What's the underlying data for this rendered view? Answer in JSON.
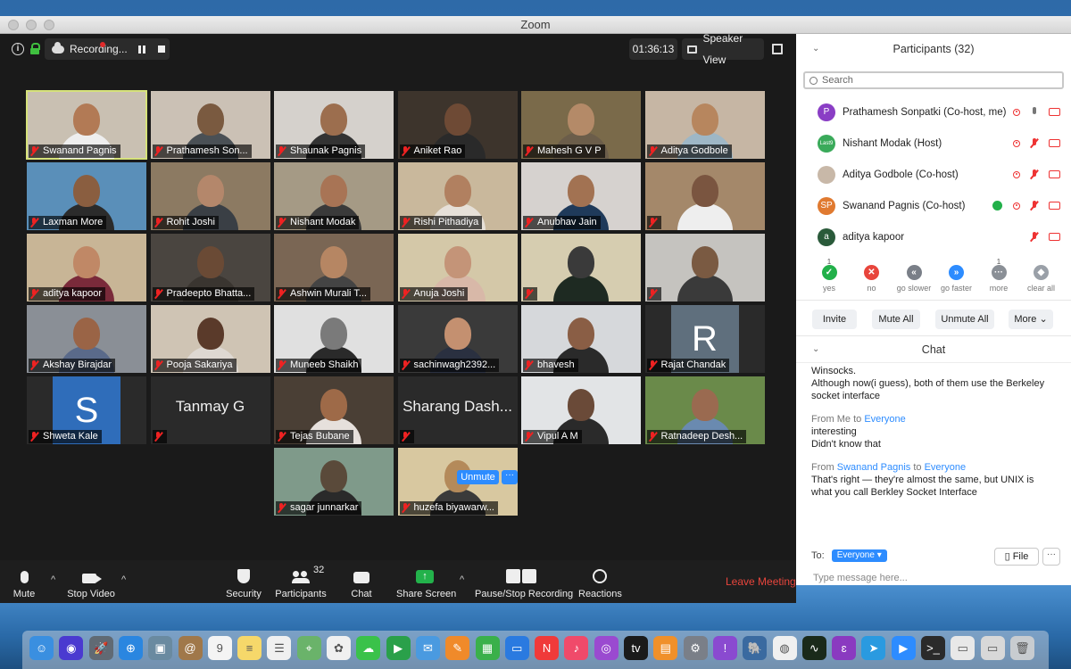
{
  "window": {
    "title": "Zoom"
  },
  "topbar": {
    "recording_label": "Recording...",
    "timer": "01:36:13",
    "view_label": "Speaker View"
  },
  "tiles": [
    {
      "name": "Swanand Pagnis",
      "type": "video",
      "skin": "#b27a55",
      "shirt": "#eee",
      "bg": "#c9c0b2",
      "active": true
    },
    {
      "name": "Prathamesh Son...",
      "type": "video",
      "skin": "#7a5a40",
      "shirt": "#4a5055",
      "bg": "#cbc1b5"
    },
    {
      "name": "Shaunak Pagnis",
      "type": "video",
      "skin": "#9c6e4e",
      "shirt": "#333",
      "bg": "#d5d1cc"
    },
    {
      "name": "Aniket Rao",
      "type": "video",
      "skin": "#6e4a35",
      "shirt": "#2a2a2a",
      "bg": "#3d342c"
    },
    {
      "name": "Mahesh G V P",
      "type": "video",
      "skin": "#b48a68",
      "shirt": "#6b5d4a",
      "bg": "#7a6a4a"
    },
    {
      "name": "Aditya Godbole",
      "type": "video",
      "skin": "#b7865e",
      "shirt": "#9eb7c6",
      "bg": "#c6b6a4"
    },
    {
      "name": "Laxman More",
      "type": "video",
      "skin": "#8a5e40",
      "shirt": "#2b2b2b",
      "bg": "#5a8fb9"
    },
    {
      "name": "Rohit Joshi",
      "type": "video",
      "skin": "#b4876b",
      "shirt": "#3a3f45",
      "bg": "#8c7a62"
    },
    {
      "name": "Nishant Modak",
      "type": "video",
      "skin": "#a87455",
      "shirt": "#3a3a3a",
      "bg": "#a59a85"
    },
    {
      "name": "Rishi Pithadiya",
      "type": "video",
      "skin": "#b18060",
      "shirt": "#e6e0d8",
      "bg": "#c9b89c"
    },
    {
      "name": "Anubhav Jain",
      "type": "video",
      "skin": "#a27252",
      "shirt": "#1f3a5a",
      "bg": "#d6d2cf"
    },
    {
      "name": "",
      "type": "video",
      "skin": "#7a5540",
      "shirt": "#eee",
      "bg": "#a4886a"
    },
    {
      "name": "aditya kapoor",
      "type": "video",
      "skin": "#c08866",
      "shirt": "#7a2a3a",
      "bg": "#c8b596"
    },
    {
      "name": "Pradeepto Bhatta...",
      "type": "video",
      "skin": "#6a4a35",
      "shirt": "#3a3530",
      "bg": "#4a4540"
    },
    {
      "name": "Ashwin Murali T...",
      "type": "video",
      "skin": "#b68663",
      "shirt": "#444",
      "bg": "#7a6654"
    },
    {
      "name": "Anuja Joshi",
      "type": "video",
      "skin": "#c49478",
      "shirt": "#d8b8a8",
      "bg": "#d4c8a8"
    },
    {
      "name": "",
      "type": "video",
      "skin": "#3a3a3a",
      "shirt": "#1e2a22",
      "bg": "#d6cdb0"
    },
    {
      "name": "",
      "type": "video",
      "skin": "#7a5a42",
      "shirt": "#3a3a3a",
      "bg": "#c5c3bf"
    },
    {
      "name": "Akshay Birajdar",
      "type": "video",
      "skin": "#9a6446",
      "shirt": "#5a6a8a",
      "bg": "#8a8f96"
    },
    {
      "name": "Pooja Sakariya",
      "type": "video",
      "skin": "#5a3a2a",
      "shirt": "#ded8d2",
      "bg": "#cfc4b4"
    },
    {
      "name": "Muneeb Shaikh",
      "type": "video",
      "skin": "#7a7a7a",
      "shirt": "#2a2a2a",
      "bg": "#e0e0e0"
    },
    {
      "name": "sachinwagh2392...",
      "type": "video",
      "skin": "#c49070",
      "shirt": "#2a3040",
      "bg": "#3a3a3a"
    },
    {
      "name": "bhavesh",
      "type": "video",
      "skin": "#8a5e45",
      "shirt": "#2a2a2a",
      "bg": "#d6d8db"
    },
    {
      "name": "Rajat Chandak",
      "type": "avatar",
      "letter": "R",
      "avatar_bg": "#5f6f7d"
    },
    {
      "name": "Shweta Kale",
      "type": "avatar",
      "letter": "S",
      "avatar_bg": "#2f6dba"
    },
    {
      "name": "",
      "type": "text",
      "label": "Tanmay G"
    },
    {
      "name": "Tejas Bubane",
      "type": "video",
      "skin": "#9e6a48",
      "shirt": "#e6e0dc",
      "bg": "#4a3f35"
    },
    {
      "name": "",
      "type": "text",
      "label": "Sharang Dash..."
    },
    {
      "name": "Vipul A M",
      "type": "video",
      "skin": "#6a4a38",
      "shirt": "#2a2a2a",
      "bg": "#e2e4e6"
    },
    {
      "name": "Ratnadeep Desh...",
      "type": "video",
      "skin": "#9a6a50",
      "shirt": "#6a8ab0",
      "bg": "#6a8a4a"
    },
    {
      "name": "sagar junnarkar",
      "type": "video",
      "skin": "#5a4a3a",
      "shirt": "#2a2a2a",
      "bg": "#7f9a8a"
    },
    {
      "name": "huzefa biyawarw...",
      "type": "video",
      "skin": "#b48a5a",
      "shirt": "#3a3a3a",
      "bg": "#d8c8a0",
      "unmute": true
    }
  ],
  "overlay": {
    "unmute_label": "Unmute",
    "more_label": "···"
  },
  "toolbar": {
    "mute": "Mute",
    "stop_video": "Stop Video",
    "security": "Security",
    "participants": "Participants",
    "participants_count": "32",
    "chat": "Chat",
    "share_screen": "Share Screen",
    "pause_stop_recording": "Pause/Stop Recording",
    "reactions": "Reactions",
    "leave": "Leave Meeting"
  },
  "participants_panel": {
    "title": "Participants (32)",
    "search_placeholder": "Search",
    "people": [
      {
        "name": "Prathamesh Sonpatki  (Co-host, me)",
        "initials": "P",
        "color": "#8a3ec5"
      },
      {
        "name": "Nishant Modak (Host)",
        "initials": "Last9",
        "color": "#3aaa5a"
      },
      {
        "name": "Aditya Godbole (Co-host)",
        "initials": "",
        "color": "#c8b8a8"
      },
      {
        "name": "Swanand Pagnis (Co-host)",
        "initials": "SP",
        "color": "#e07a30"
      },
      {
        "name": "aditya kapoor",
        "initials": "a",
        "color": "#2a5a3a"
      }
    ],
    "feedback": [
      {
        "label": "yes",
        "count": "1",
        "color": "#22b04a",
        "glyph": "✓"
      },
      {
        "label": "no",
        "count": "",
        "color": "#e8453c",
        "glyph": "✕"
      },
      {
        "label": "go slower",
        "count": "",
        "color": "#7a7f88",
        "glyph": "«"
      },
      {
        "label": "go faster",
        "count": "",
        "color": "#2d8cff",
        "glyph": "»"
      },
      {
        "label": "more",
        "count": "1",
        "color": "#8a8f96",
        "glyph": "···"
      },
      {
        "label": "clear all",
        "count": "",
        "color": "#9aa0a8",
        "glyph": "◆"
      }
    ],
    "buttons": {
      "invite": "Invite",
      "mute_all": "Mute All",
      "unmute_all": "Unmute All",
      "more": "More ⌄"
    }
  },
  "chat": {
    "title": "Chat",
    "messages": [
      {
        "from": "",
        "to": "",
        "lines": [
          "Winsocks.",
          "Although now(i guess), both of them use the Berkeley",
          "socket interface"
        ]
      },
      {
        "from": "Me",
        "to": "Everyone",
        "lines": [
          "interesting",
          "Didn't know that"
        ]
      },
      {
        "from": "Swanand Pagnis",
        "to": "Everyone",
        "lines": [
          "That's right — they're almost the same, but UNIX is",
          "what you call Berkley Socket Interface"
        ]
      }
    ],
    "from_label": "From",
    "to_label": "to",
    "to_field_label": "To:",
    "recipient": "Everyone ▾",
    "file_label": "File",
    "more_label": "···",
    "input_placeholder": "Type message here..."
  },
  "dock": {
    "apps": [
      {
        "name": "finder-icon",
        "color": "#3a8fe0",
        "glyph": "☺"
      },
      {
        "name": "siri-icon",
        "color": "#4a3ad0",
        "glyph": "◉"
      },
      {
        "name": "launchpad-icon",
        "color": "#606a74",
        "glyph": "🚀"
      },
      {
        "name": "safari-icon",
        "color": "#2a86e0",
        "glyph": "⊕"
      },
      {
        "name": "preview-icon",
        "color": "#6a8aa0",
        "glyph": "▣"
      },
      {
        "name": "contacts-icon",
        "color": "#a0784a",
        "glyph": "@"
      },
      {
        "name": "calendar-icon",
        "color": "#f4f4f4",
        "glyph": "9"
      },
      {
        "name": "notes-icon",
        "color": "#f6d86a",
        "glyph": "≡"
      },
      {
        "name": "reminders-icon",
        "color": "#f0f0f0",
        "glyph": "☰"
      },
      {
        "name": "maps-icon",
        "color": "#6ab36a",
        "glyph": "⌖"
      },
      {
        "name": "photos-icon",
        "color": "#f0f0f0",
        "glyph": "✿"
      },
      {
        "name": "messages-icon",
        "color": "#3ac24a",
        "glyph": "☁"
      },
      {
        "name": "facetime-icon",
        "color": "#2aa04a",
        "glyph": "▶"
      },
      {
        "name": "mail-icon",
        "color": "#4a9ae0",
        "glyph": "✉"
      },
      {
        "name": "pages-icon",
        "color": "#f08a2a",
        "glyph": "✎"
      },
      {
        "name": "numbers-icon",
        "color": "#3ab04a",
        "glyph": "▦"
      },
      {
        "name": "keynote-icon",
        "color": "#2a7ae0",
        "glyph": "▭"
      },
      {
        "name": "news-icon",
        "color": "#f03a3a",
        "glyph": "N"
      },
      {
        "name": "music-icon",
        "color": "#f04a6a",
        "glyph": "♪"
      },
      {
        "name": "podcasts-icon",
        "color": "#9a4ad0",
        "glyph": "◎"
      },
      {
        "name": "tv-icon",
        "color": "#1a1a1a",
        "glyph": "tv"
      },
      {
        "name": "books-icon",
        "color": "#f0902a",
        "glyph": "▤"
      },
      {
        "name": "system-preferences-icon",
        "color": "#7a7f88",
        "glyph": "⚙"
      },
      {
        "name": "feedback-icon",
        "color": "#8a4ad0",
        "glyph": "!"
      },
      {
        "name": "postgres-icon",
        "color": "#3a6aa0",
        "glyph": "🐘"
      },
      {
        "name": "chrome-icon",
        "color": "#f0f0f0",
        "glyph": "◍"
      },
      {
        "name": "activity-monitor-icon",
        "color": "#1a2a1a",
        "glyph": "∿"
      },
      {
        "name": "emacs-icon",
        "color": "#8a3ac0",
        "glyph": "ɛ"
      },
      {
        "name": "telegram-icon",
        "color": "#2a9ae0",
        "glyph": "➤"
      },
      {
        "name": "zoom-icon",
        "color": "#2d8cff",
        "glyph": "▶"
      },
      {
        "name": "terminal-icon",
        "color": "#2a2a2a",
        "glyph": ">_"
      },
      {
        "name": "screenshot-icon",
        "color": "#e8e8e8",
        "glyph": "▭"
      },
      {
        "name": "window-icon",
        "color": "#d8d8d8",
        "glyph": "▭"
      },
      {
        "name": "trash-icon",
        "color": "#c8ccd0",
        "glyph": "🗑"
      }
    ]
  }
}
